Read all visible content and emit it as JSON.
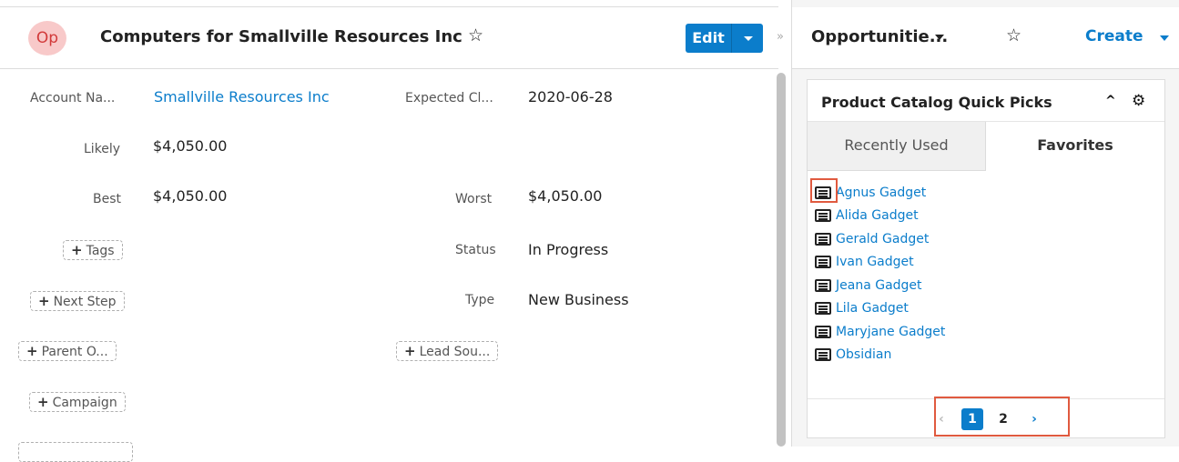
{
  "record": {
    "module_abbr": "Op",
    "title": "Computers for Smallville Resources Inc",
    "favorite_icon": "star-outline-icon",
    "edit_label": "Edit"
  },
  "fields": {
    "account_name": {
      "label": "Account Na...",
      "value": "Smallville Resources Inc"
    },
    "expected_close": {
      "label": "Expected Cl...",
      "value": "2020-06-28"
    },
    "likely": {
      "label": "Likely",
      "value": "$4,050.00"
    },
    "best": {
      "label": "Best",
      "value": "$4,050.00"
    },
    "worst": {
      "label": "Worst",
      "value": "$4,050.00"
    },
    "status": {
      "label": "Status",
      "value": "In Progress"
    },
    "type": {
      "label": "Type",
      "value": "New Business"
    }
  },
  "empty_fields": {
    "tags": "Tags",
    "next_step": "Next Step",
    "parent_opportunity": "Parent O...",
    "lead_source": "Lead Sou...",
    "campaign": "Campaign"
  },
  "sidebar_toggle": "»",
  "dashboard": {
    "title": "Opportunitie...",
    "create_label": "Create"
  },
  "dashlet": {
    "title": "Product Catalog Quick Picks",
    "tabs": [
      {
        "label": "Recently Used",
        "active": false
      },
      {
        "label": "Favorites",
        "active": true
      }
    ],
    "items": [
      "Agnus Gadget",
      "Alida Gadget",
      "Gerald Gadget",
      "Ivan Gadget",
      "Jeana Gadget",
      "Lila Gadget",
      "Maryjane Gadget",
      "Obsidian"
    ],
    "pagination": {
      "prev": "‹",
      "pages": [
        "1",
        "2"
      ],
      "current": "1",
      "next": "›"
    }
  },
  "colors": {
    "accent": "#0b7dcb",
    "highlight": "#e05a3f",
    "badge_bg": "#f8c9c9",
    "badge_text": "#d23a3a"
  }
}
